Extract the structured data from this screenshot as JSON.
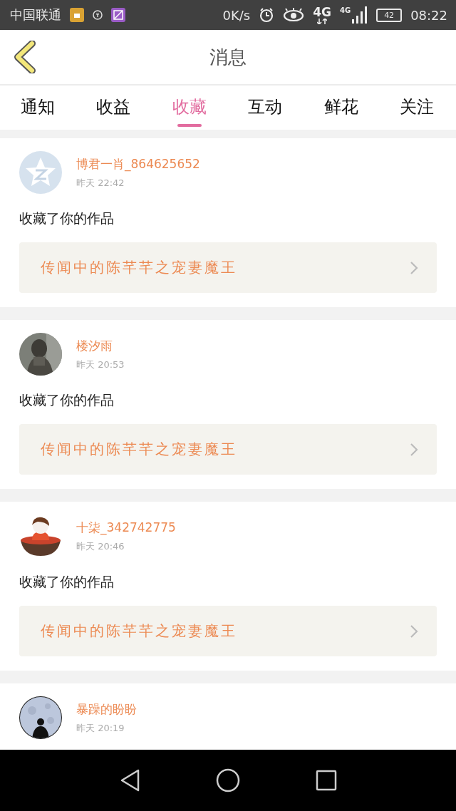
{
  "status_bar": {
    "carrier": "中国联通",
    "speed": "0K/s",
    "data_type": "4G",
    "signal_type": "4G",
    "battery": "42",
    "time": "08:22"
  },
  "header": {
    "title": "消息"
  },
  "tabs": [
    {
      "label": "通知",
      "selected": false
    },
    {
      "label": "收益",
      "selected": false
    },
    {
      "label": "收藏",
      "selected": true
    },
    {
      "label": "互动",
      "selected": false
    },
    {
      "label": "鲜花",
      "selected": false
    },
    {
      "label": "关注",
      "selected": false
    }
  ],
  "messages": [
    {
      "user": "博君一肖_864625652",
      "time": "昨天 22:42",
      "avatar": {
        "kind": "default"
      },
      "text": "收藏了你的作品",
      "work": "传闻中的陈芊芊之宠妻魔王"
    },
    {
      "user": "楼汐雨",
      "time": "昨天 20:53",
      "text": "收藏了你的作品",
      "work": "传闻中的陈芊芊之宠妻魔王"
    },
    {
      "user": "十柒_342742775",
      "time": "昨天 20:46",
      "avatar": {
        "kind": "cartoon"
      },
      "text": "收藏了你的作品",
      "work": "传闻中的陈芊芊之宠妻魔王"
    },
    {
      "user": "暴躁的盼盼",
      "time": "昨天 20:19",
      "avatar": {
        "kind": "moon"
      }
    }
  ]
}
